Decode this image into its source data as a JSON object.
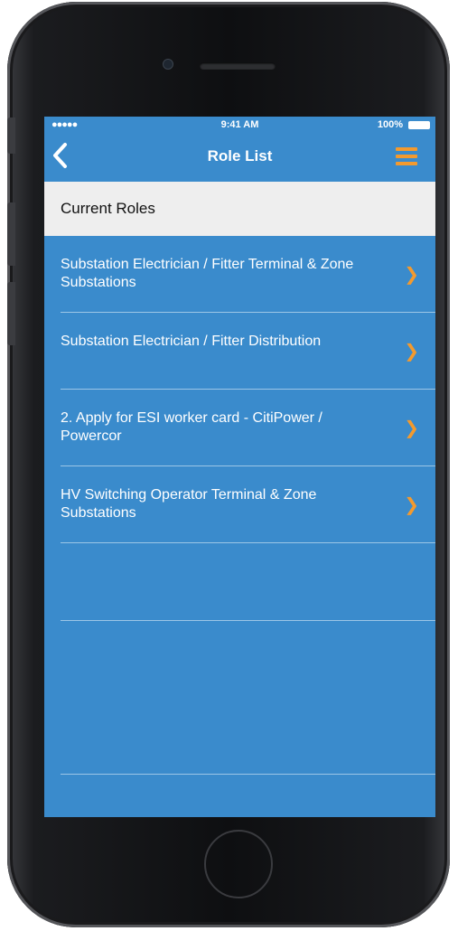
{
  "status_bar": {
    "signal": "●●●●● ",
    "time": "9:41 AM",
    "battery": "100%"
  },
  "nav": {
    "title": "Role List",
    "back_icon": "chevron-left-icon",
    "menu_icon": "hamburger-menu-icon"
  },
  "section": {
    "header": "Current Roles"
  },
  "roles": [
    {
      "label": "Substation Electrician / Fitter Terminal & Zone Substations"
    },
    {
      "label": "Substation Electrician / Fitter Distribution"
    },
    {
      "label": "2. Apply for ESI worker card - CitiPower / Powercor"
    },
    {
      "label": "HV Switching Operator Terminal & Zone Substations"
    }
  ],
  "colors": {
    "screen_background": "#3a8bcc",
    "accent": "#f39a2e",
    "section_header_background": "#eeeeee"
  }
}
